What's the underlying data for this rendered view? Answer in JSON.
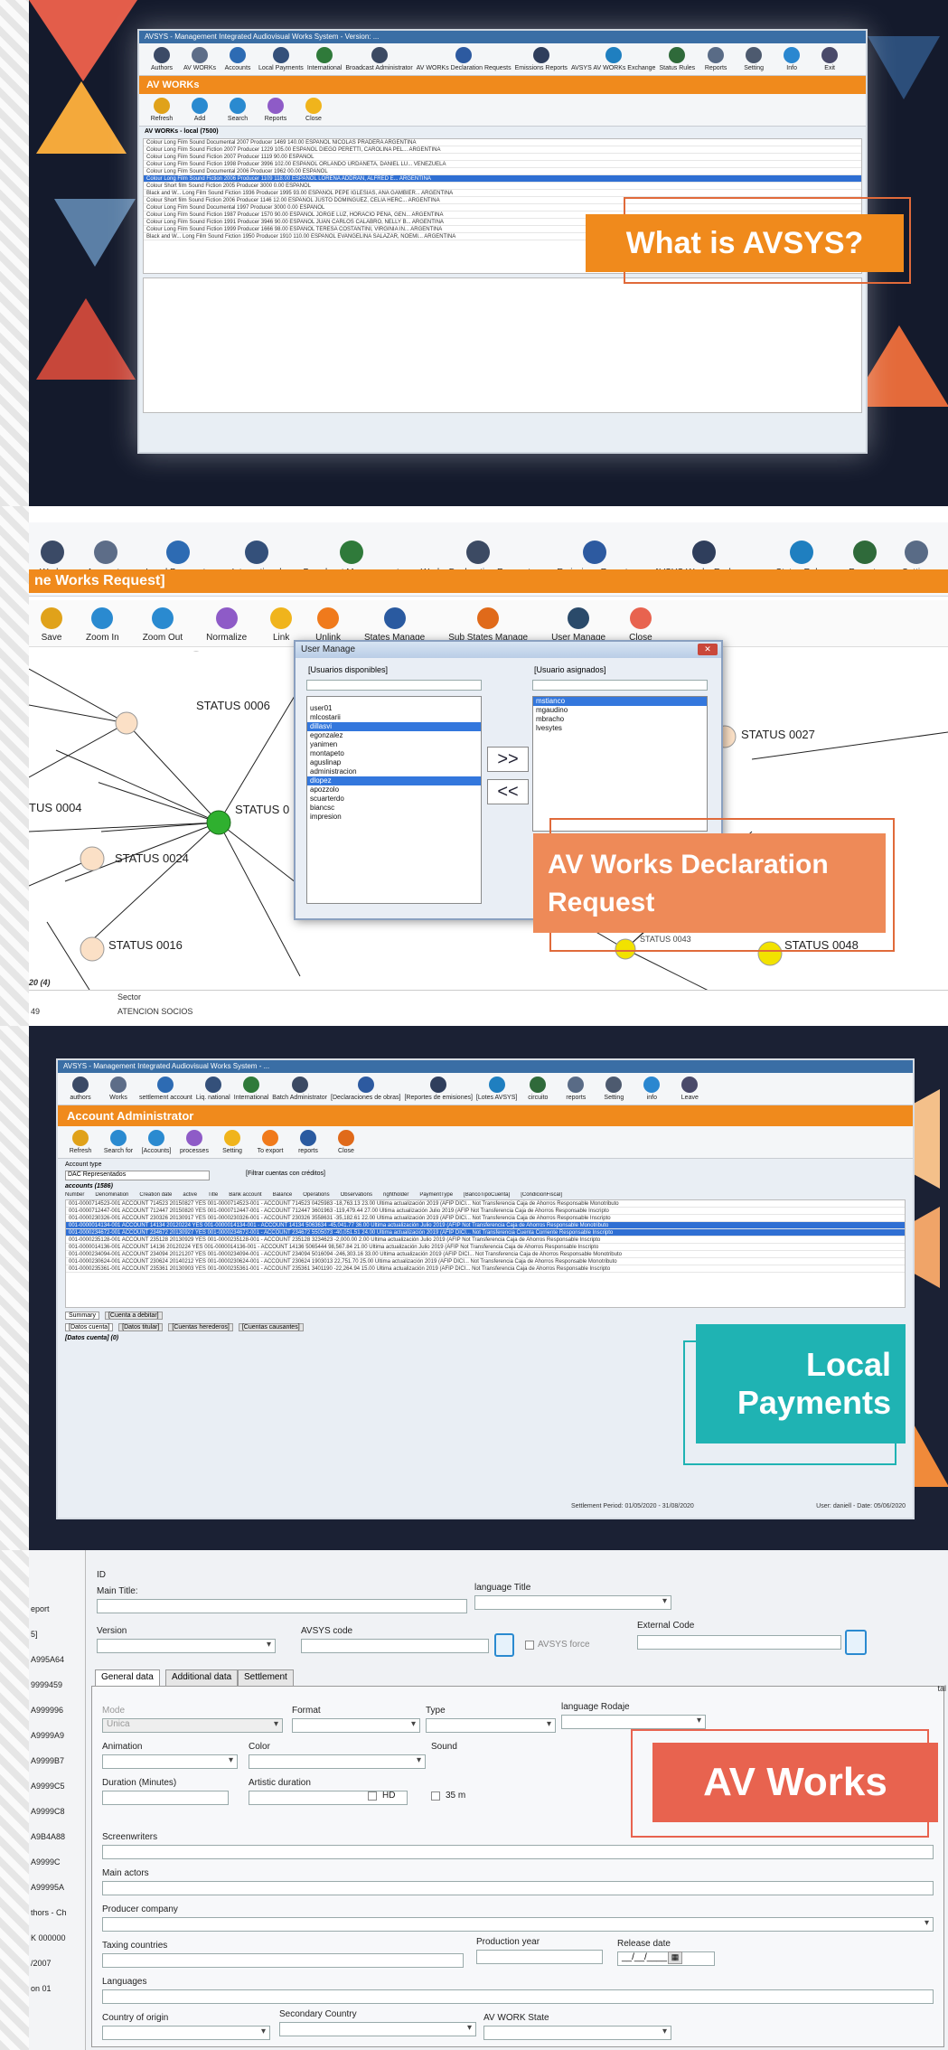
{
  "panel1": {
    "window_title": "AVSYS - Management Integrated Audiovisual Works System - Version: ...",
    "toolbar": [
      "Authors",
      "AV WORKs",
      "Accounts",
      "Local Payments",
      "International",
      "Broadcast Administrator",
      "AV WORKs Declaration Requests",
      "Emissions Reports",
      "AVSYS AV WORKs Exchange",
      "Status Rules",
      "Reports",
      "Setting",
      "Info",
      "Exit"
    ],
    "section": "AV WORKs",
    "subtoolbar": [
      "Refresh",
      "Add",
      "Search",
      "Reports",
      "Close"
    ],
    "grid_caption": "AV WORKs - local (7500)",
    "rows": [
      "Colour  Long Film  Sound  Documental  2007  Producer 1469  140.00  ESPAÑOL  NICOLAS PRADERA  ARGENTINA",
      "Colour  Long Film  Sound  Fiction  2007  Producer 1229  105.00  ESPAÑOL  DIEGO PERETTI, CAROLINA PEL...  ARGENTINA",
      "Colour  Long Film  Sound  Fiction  2007  Producer 1119  90.00  ESPAÑOL",
      "Colour  Long Film  Sound  Fiction  1998  Producer 3996  102.00  ESPAÑOL  ORLANDO URDANETA, DANIEL LU...  VENEZUELA",
      "Colour  Long Film  Sound  Documental  2006  Producer 1962  00.00  ESPAÑOL",
      "Colour  Long Film  Sound  Fiction  2006  Producer 1109  118.00  ESPAÑOL  LORENA ADDRAN, ALFRED E...  ARGENTINA",
      "Colour  Short film  Sound  Fiction  2005  Producer 3000  0.00  ESPAÑOL",
      "Black and W...  Long Film  Sound  Fiction  1936  Producer 1995  93.00  ESPAÑOL  PEPE IGLESIAS, ANA GAMBIER...  ARGENTINA",
      "Colour  Short film  Sound  Fiction  2006  Producer 1146  12.00  ESPAÑOL  JUSTO DOMINGUEZ, CELIA HERC...  ARGENTINA",
      "Colour  Long Film  Sound  Documental  1997  Producer 3000  0.00  ESPAÑOL",
      "Colour  Long Film  Sound  Fiction  1987  Producer 1570  90.00  ESPAÑOL  JORGE LUZ, HORACIO PEÑA, GEN...  ARGENTINA",
      "Colour  Long Film  Sound  Fiction  1991  Producer 3946  90.00  ESPAÑOL  JUAN CARLOS CALABRO, NELLY B...  ARGENTINA",
      "Colour  Long Film  Sound  Fiction  1999  Producer 1666  98.00  ESPAÑOL  TERESA COSTANTINI, VIRGINIA IN...  ARGENTINA",
      "Black and W...  Long Film  Sound  Fiction  1950  Producer 1910  110.00  ESPAÑOL  EVANGELINA SALAZAR, NOEMI...  ARGENTINA"
    ],
    "callout": "What is AVSYS?"
  },
  "panel2": {
    "toolbar": [
      "Works",
      "Accounts",
      "Local Payments",
      "International",
      "Broadcast Management",
      "Works Declaration Requests",
      "Emissions Reports",
      "AVSYS Works Exchange",
      "Status Rules",
      "Reports",
      "Setting"
    ],
    "section": "ne Works Request]",
    "subtoolbar": [
      "Save",
      "Zoom In",
      "Zoom Out",
      "Normalize",
      "Link",
      "Unlink",
      "States Manage",
      "Sub States Manage",
      "User Manage",
      "Close"
    ],
    "nodes": [
      "STATUS 0006",
      "STATUS 0",
      "TUS 0004",
      "STATUS 0024",
      "STATUS 0016",
      "STATUS 0027",
      "STATUS 0048",
      "STATUS 0043"
    ],
    "dialog": {
      "title": "User Manage",
      "available_label": "[Usuarios disponibles]",
      "assigned_label": "[Usuario asignados]",
      "available": [
        "user01",
        "mlcostarii",
        "dillasvi",
        "egonzalez",
        "yanimen",
        "montapeto",
        "aguslinap",
        "administracion",
        "dlopez",
        "apozzolo",
        "scuarterdo",
        "biancsc",
        "impresion"
      ],
      "available_selected": [
        "dillasvi",
        "dlopez"
      ],
      "assigned": [
        "mstianco",
        "mgaudino",
        "mbracho",
        "lvesytes"
      ],
      "assigned_selected": [
        "mstianco"
      ],
      "add_label": ">>",
      "remove_label": "<<"
    },
    "callout": "AV Works Declaration Request",
    "footer_left": "20 (4)",
    "footer_sector_label": "Sector",
    "footer_num": "49",
    "footer_sector_value": "ATENCION SOCIOS"
  },
  "panel3": {
    "window_title": "AVSYS - Management Integrated Audiovisual Works System - ...",
    "toolbar": [
      "authors",
      "Works",
      "settlement account",
      "Liq. national",
      "International",
      "Batch Administrator",
      "[Declaraciones de obras]",
      "[Reportes de emisiones]",
      "[Lotes AVSYS]",
      "circuito",
      "reports",
      "Setting",
      "info",
      "Leave"
    ],
    "section": "Account Administrator",
    "subtoolbar": [
      "Refresh",
      "Search for",
      "[Accounts]",
      "processes",
      "Setting",
      "To export",
      "reports",
      "Close"
    ],
    "account_type_label": "Account type",
    "account_type_value": "DAC Representados",
    "filter_label": "[Filtrar cuentas con créditos]",
    "grid_caption": "accounts (1586)",
    "columns": [
      "Number",
      "Denomination",
      "Creation date",
      "active",
      "Title",
      "Bank account",
      "Balance",
      "Operations",
      "Observations",
      "rightholder",
      "PaymentType",
      "[BancoTipoCuenta]",
      "[CondicionFiscal]"
    ],
    "rows": [
      "001-0000714523-001  ACCOUNT 714523  20150827  YES  001-0000714523-001 - ACCOUNT 714523  0425983  -18,763.13  23.00  Ultima actualización 2019 (AFIP DICI...  Not  Transferencia  Caja de Ahorros  Responsable Monotributo",
      "001-0000712447-001  ACCOUNT 712447  20150820  YES  001-0000712447-001 - ACCOUNT 712447  3601963  -119,479.44  27.00  Ultima actualización Julio 2019 (AFIP  Not  Transferencia  Caja de Ahorros  Responsable Inscripto",
      "001-0000230326-001  ACCOUNT 230326  20130917  YES  001-0000230326-001 - ACCOUNT 230326  3558631  -35,182.61  22.00  Ultima actualización 2019 (AFIP DICI...  Not  Transferencia  Caja de Ahorros  Responsable Inscripto",
      "001-0000014134-001  ACCOUNT 14134  20120224  YES  001-0000014134-001 - ACCOUNT 14134  5063634  -45,041.77  36.00  Ultima actualización Julio 2019 (AFIP  Not  Transferencia  Caja de Ahorros  Responsable Monotributo",
      "001-0000234672-001  ACCOUNT 234672  20130927  YES  001-0000234672-001 - ACCOUNT 234672  5505073  -40,051.51  24.00  Ultima actualización 2019 (AFIP DICI...  Not  Transferencia  Cuenta Corriente  Responsable Inscripto",
      "001-0000235128-001  ACCOUNT 235128  20130929  YES  001-0000235128-001 - ACCOUNT 235128  3234623  -2,000.00  2.00  Ultima actualización Julio 2019 (AFIP  Not  Transferencia  Caja de Ahorros  Responsable Inscripto",
      "001-0000014136-001  ACCOUNT 14136  20120224  YES  001-0000014136-001 - ACCOUNT 14136  5065444  98,567.84  21.00  Ultima actualización Julio 2019 (AFIP  Not  Transferencia  Caja de Ahorros  Responsable Inscripto",
      "001-0000234094-001  ACCOUNT 234094  20121207  YES  001-0000234094-001 - ACCOUNT 234094  5016094  -246,303.16  33.00  Ultima actualización 2019 (AFIP DICI...  Not  Transferencia  Caja de Ahorros  Responsable Monotributo",
      "001-0000230624-001  ACCOUNT 230624  20140212  YES  001-0000230624-001 - ACCOUNT 230624  1903013  22,751.70  25.00  Ultima actualización 2019 (AFIP DICI...  Not  Transferencia  Caja de Ahorros  Responsable Monotributo",
      "001-0000235361-001  ACCOUNT 235361  20130903  YES  001-0000235361-001 - ACCOUNT 235361  3401190  -22,264.94  15.00  Ultima actualización 2019 (AFIP DICI...  Not  Transferencia  Caja de Ahorros  Responsable Inscripto"
    ],
    "tabs": [
      "Summary",
      "[Cuenta a debitar]"
    ],
    "subtabs": [
      "[Datos cuenta]",
      "[Datos titular]",
      "[Cuentas herederos]",
      "[Cuentas causantes]"
    ],
    "detail_caption": "[Datos cuenta] (0)",
    "status_center": "Settlement Period: 01/05/2020 - 31/08/2020",
    "status_right": "User: daniell - Date: 05/06/2020",
    "callout": "Local Payments"
  },
  "panel4": {
    "left_items": [
      "eport",
      "5]",
      "A995A64",
      "9999459",
      "A999996",
      "A9999A9",
      "A9999B7",
      "A9999C5",
      "A9999C8",
      "A9B4A88",
      "A9999C",
      "A99995A",
      "thors - Ch",
      "K 000000",
      "/2007",
      "on 01"
    ],
    "id_label": "ID",
    "main_title_label": "Main Title:",
    "language_title_label": "language Title",
    "version_label": "Version",
    "avsys_code_label": "AVSYS code",
    "avsys_force_label": "AVSYS force",
    "external_code_label": "External Code",
    "tabs": [
      "General data",
      "Additional data",
      "Settlement"
    ],
    "mode_label": "Mode",
    "mode_value": "Unica",
    "format_label": "Format",
    "type_label": "Type",
    "language_rodaje_label": "language Rodaje",
    "animation_label": "Animation",
    "color_label": "Color",
    "sound_label": "Sound",
    "duration_label": "Duration (Minutes)",
    "artistic_duration_label": "Artistic duration",
    "hd_label": "HD",
    "mm35_label": "35 m",
    "screenwriters_label": "Screenwriters",
    "main_actors_label": "Main actors",
    "producer_company_label": "Producer company",
    "taxing_countries_label": "Taxing countries",
    "production_year_label": "Production year",
    "release_date_label": "Release date",
    "release_date_value": "__/__/____",
    "languages_label": "Languages",
    "country_origin_label": "Country of origin",
    "secondary_country_label": "Secondary Country",
    "av_work_state_label": "AV WORK State",
    "callout": "AV Works",
    "side_cut": "tal"
  },
  "colors": {
    "orange": "#f08a1c",
    "callout_red": "#e8634f",
    "callout_teal": "#1fb3b3",
    "selection_blue": "#2f6fd3"
  }
}
